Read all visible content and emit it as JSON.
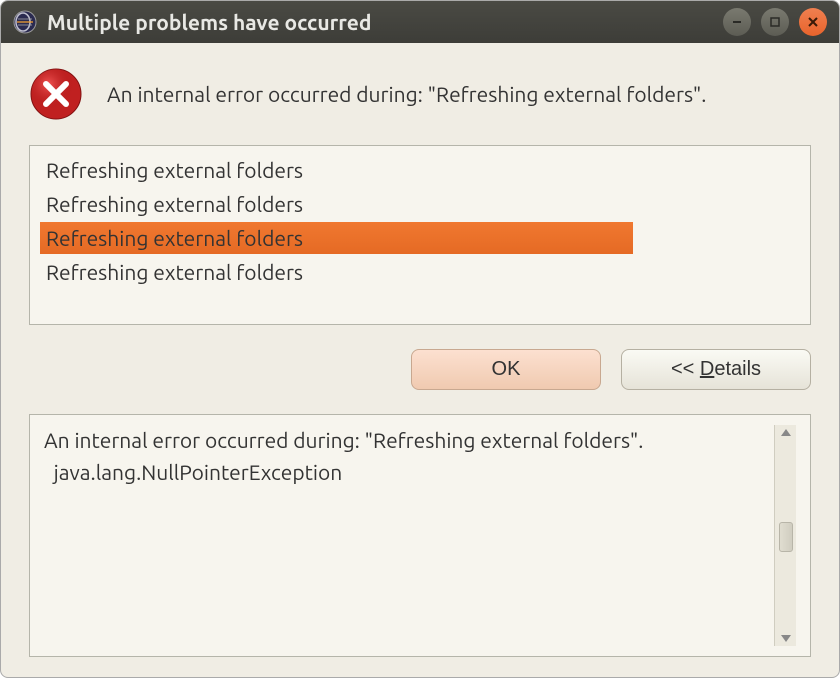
{
  "titlebar": {
    "title": "Multiple problems have occurred"
  },
  "header": {
    "message": "An internal error occurred during: \"Refreshing external folders\"."
  },
  "problems": {
    "items": [
      {
        "label": "Refreshing external folders",
        "selected": false
      },
      {
        "label": "Refreshing external folders",
        "selected": false
      },
      {
        "label": "Refreshing external folders",
        "selected": true
      },
      {
        "label": "Refreshing external folders",
        "selected": false
      }
    ]
  },
  "buttons": {
    "ok_label": "OK",
    "details_prefix": "<< ",
    "details_underline": "D",
    "details_suffix": "etails"
  },
  "details": {
    "line1": "An internal error occurred during: \"Refreshing external folders\".",
    "line2": "  java.lang.NullPointerException"
  }
}
